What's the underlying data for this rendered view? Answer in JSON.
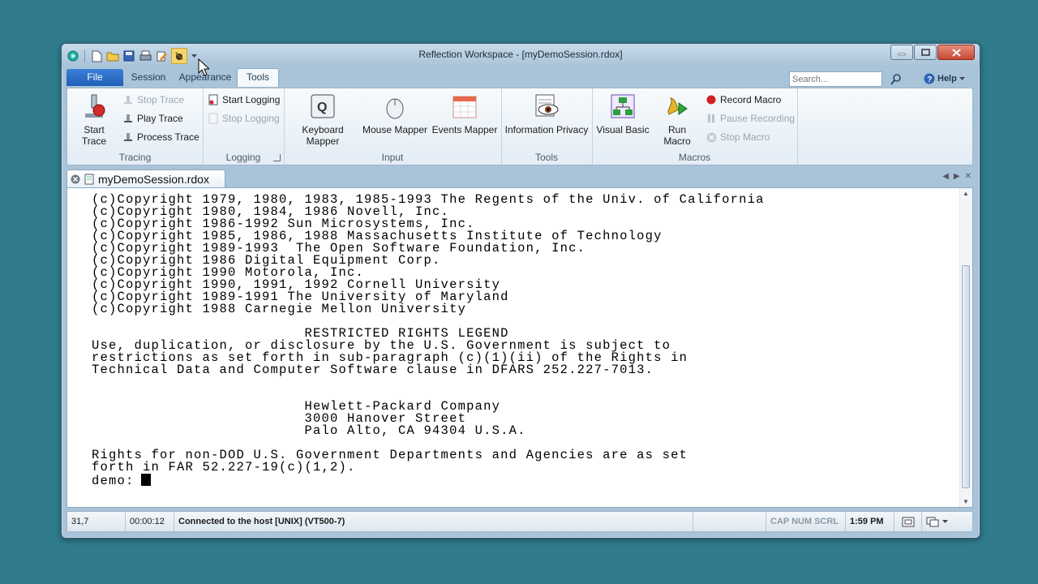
{
  "window": {
    "title": "Reflection Workspace - [myDemoSession.rdox]"
  },
  "quick_access": [
    {
      "icon": "app-globe-icon"
    },
    {
      "icon": "new-document-icon"
    },
    {
      "icon": "open-folder-icon"
    },
    {
      "icon": "save-icon"
    },
    {
      "icon": "print-icon"
    },
    {
      "icon": "edit-icon"
    },
    {
      "icon": "connect-icon"
    }
  ],
  "ribbon_tabs": [
    "File",
    "Session",
    "Appearance",
    "Tools"
  ],
  "active_tab": "Tools",
  "search": {
    "placeholder": "Search..."
  },
  "help_label": "Help",
  "groups": {
    "tracing": {
      "label": "Tracing",
      "start_trace": "Start Trace",
      "stop_trace": "Stop Trace",
      "play_trace": "Play Trace",
      "process_trace": "Process Trace"
    },
    "logging": {
      "label": "Logging",
      "start_logging": "Start Logging",
      "stop_logging": "Stop Logging"
    },
    "input": {
      "label": "Input",
      "keyboard_mapper": "Keyboard Mapper",
      "mouse_mapper": "Mouse Mapper",
      "events_mapper": "Events Mapper"
    },
    "tools": {
      "label": "Tools",
      "information_privacy": "Information Privacy"
    },
    "macros": {
      "label": "Macros",
      "visual_basic": "Visual Basic",
      "run_macro": "Run Macro",
      "record_macro": "Record Macro",
      "pause_recording": "Pause Recording",
      "stop_macro": "Stop Macro"
    }
  },
  "document_tab": "myDemoSession.rdox",
  "terminal": {
    "lines": [
      "(c)Copyright 1979, 1980, 1983, 1985-1993 The Regents of the Univ. of California",
      "(c)Copyright 1980, 1984, 1986 Novell, Inc.",
      "(c)Copyright 1986-1992 Sun Microsystems, Inc.",
      "(c)Copyright 1985, 1986, 1988 Massachusetts Institute of Technology",
      "(c)Copyright 1989-1993  The Open Software Foundation, Inc.",
      "(c)Copyright 1986 Digital Equipment Corp.",
      "(c)Copyright 1990 Motorola, Inc.",
      "(c)Copyright 1990, 1991, 1992 Cornell University",
      "(c)Copyright 1989-1991 The University of Maryland",
      "(c)Copyright 1988 Carnegie Mellon University",
      "",
      "                         RESTRICTED RIGHTS LEGEND",
      "Use, duplication, or disclosure by the U.S. Government is subject to",
      "restrictions as set forth in sub-paragraph (c)(1)(ii) of the Rights in",
      "Technical Data and Computer Software clause in DFARS 252.227-7013.",
      "",
      "",
      "                         Hewlett-Packard Company",
      "                         3000 Hanover Street",
      "                         Palo Alto, CA 94304 U.S.A.",
      "",
      "Rights for non-DOD U.S. Government Departments and Agencies are as set",
      "forth in FAR 52.227-19(c)(1,2)."
    ],
    "prompt": "demo:"
  },
  "status": {
    "cursor_pos": "31,7",
    "elapsed": "00:00:12",
    "connection": "Connected to the host [UNIX] (VT500-7)",
    "indicators": "CAP NUM SCRL",
    "time": "1:59 PM"
  }
}
